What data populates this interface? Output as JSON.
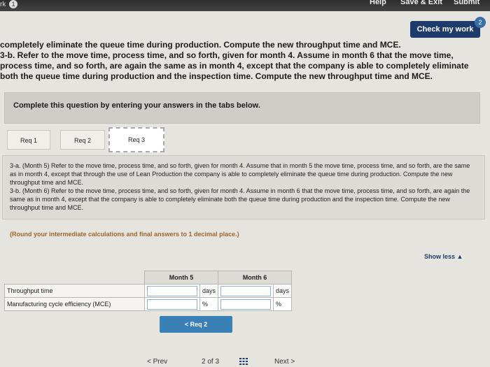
{
  "topbar": {
    "left_label": "rk",
    "left_badge": "1",
    "help": "Help",
    "save_exit": "Save & Exit",
    "submit": "Submit"
  },
  "check": {
    "label": "Check my work",
    "badge": "2"
  },
  "intro": {
    "line1": "completely eliminate the queue time during production. Compute the new throughput time and MCE.",
    "line2": "3-b. Refer to the move time, process time, and so forth, given for month 4. Assume in month 6 that the move time, process time, and so forth, are again the same as in month 4, except that the company is able to completely eliminate both the queue time during production and the inspection time. Compute the new throughput time and MCE."
  },
  "instructions": "Complete this question by entering your answers in the tabs below.",
  "tabs": [
    {
      "label": "Req 1"
    },
    {
      "label": "Req 2"
    },
    {
      "label": "Req 3"
    }
  ],
  "question": {
    "text_a": "3-a. (Month 5) Refer to the move time, process time, and so forth, given for month 4. Assume that in month 5 the move time, process time, and so forth, are the same as in month 4, except that through the use of Lean Production the company is able to completely eliminate the queue time during production. Compute the new throughput time and MCE.",
    "text_b": "3-b. (Month 6) Refer to the move time, process time, and so forth, given for month 4. Assume in month 6 that the move time, process time, and so forth, are again the same as in month 4, except that the company is able to completely eliminate both the queue time during production and the inspection time. Compute the new throughput time and MCE."
  },
  "round_note": "(Round your intermediate calculations and final answers to 1 decimal place.)",
  "show_less": "Show less ▲",
  "table": {
    "col_month5": "Month 5",
    "col_month6": "Month 6",
    "rows": [
      {
        "label": "Throughput time",
        "m5_value": "",
        "m5_unit": "days",
        "m6_value": "",
        "m6_unit": "days"
      },
      {
        "label": "Manufacturing cycle efficiency (MCE)",
        "m5_value": "",
        "m5_unit": "%",
        "m6_value": "",
        "m6_unit": "%"
      }
    ]
  },
  "prev_req_button": "< Req 2",
  "pager": {
    "prev": "< Prev",
    "pages": "2 of 3",
    "next": "Next >"
  }
}
